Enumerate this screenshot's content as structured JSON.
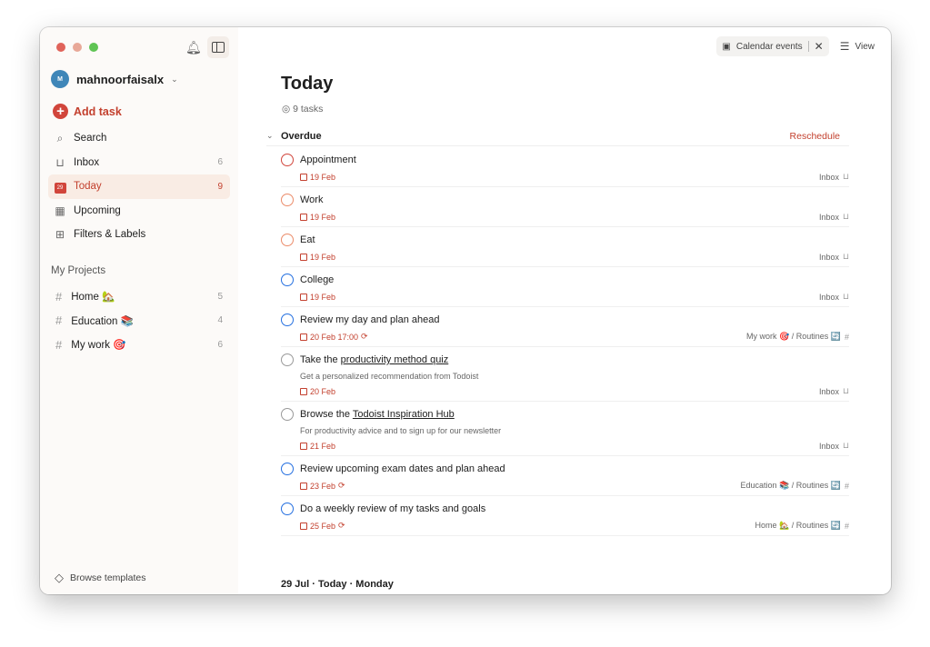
{
  "sidebar": {
    "username": "mahnoorfaisalx",
    "avatar_initial": "M",
    "add_task": "Add task",
    "nav": [
      {
        "label": "Search",
        "icon": "search-icon",
        "count": ""
      },
      {
        "label": "Inbox",
        "icon": "inbox-icon",
        "count": "6"
      },
      {
        "label": "Today",
        "icon": "calendar-today-icon",
        "count": "9",
        "day": "29"
      },
      {
        "label": "Upcoming",
        "icon": "calendar-grid-icon",
        "count": ""
      },
      {
        "label": "Filters & Labels",
        "icon": "grid-icon",
        "count": ""
      }
    ],
    "projects_header": "My Projects",
    "projects": [
      {
        "label": "Home 🏡",
        "count": "5"
      },
      {
        "label": "Education 📚",
        "count": "4"
      },
      {
        "label": "My work 🎯",
        "count": "6"
      }
    ],
    "browse_templates": "Browse templates"
  },
  "toolbar": {
    "calendar_events": "Calendar events",
    "view": "View"
  },
  "main": {
    "title": "Today",
    "task_count": "9 tasks",
    "section": "Overdue",
    "reschedule": "Reschedule",
    "tasks": [
      {
        "pre": "Appointment",
        "link": "",
        "desc": "",
        "date": "19 Feb",
        "recurring": false,
        "project": "Inbox",
        "priority_color": "#d1453b"
      },
      {
        "pre": "Work",
        "link": "",
        "desc": "",
        "date": "19 Feb",
        "recurring": false,
        "project": "Inbox",
        "priority_color": "#eb8b69"
      },
      {
        "pre": "Eat",
        "link": "",
        "desc": "",
        "date": "19 Feb",
        "recurring": false,
        "project": "Inbox",
        "priority_color": "#eb8b69"
      },
      {
        "pre": "College",
        "link": "",
        "desc": "",
        "date": "19 Feb",
        "recurring": false,
        "project": "Inbox",
        "priority_color": "#246fe0"
      },
      {
        "pre": "Review my day and plan ahead",
        "link": "",
        "desc": "",
        "date": "20 Feb 17:00",
        "recurring": true,
        "project": "My work 🎯 / Routines 🔄",
        "priority_color": "#246fe0"
      },
      {
        "pre": "Take the ",
        "link": "productivity method quiz",
        "desc": "Get a personalized recommendation from Todoist",
        "date": "20 Feb",
        "recurring": false,
        "project": "Inbox",
        "priority_color": "#999999"
      },
      {
        "pre": "Browse the ",
        "link": "Todoist Inspiration Hub",
        "desc": "For productivity advice and to sign up for our newsletter",
        "date": "21 Feb",
        "recurring": false,
        "project": "Inbox",
        "priority_color": "#999999"
      },
      {
        "pre": "Review upcoming exam dates and plan ahead",
        "link": "",
        "desc": "",
        "date": "23 Feb",
        "recurring": true,
        "project": "Education 📚 / Routines 🔄",
        "priority_color": "#246fe0"
      },
      {
        "pre": "Do a weekly review of my tasks and goals",
        "link": "",
        "desc": "",
        "date": "25 Feb",
        "recurring": true,
        "project": "Home 🏡 / Routines 🔄",
        "priority_color": "#246fe0"
      }
    ],
    "next_day": "29 Jul · Today · Monday"
  },
  "colors": {
    "accent": "#d1453b",
    "sidebar_bg": "#fcfaf8",
    "active_bg": "#f9ece4"
  }
}
